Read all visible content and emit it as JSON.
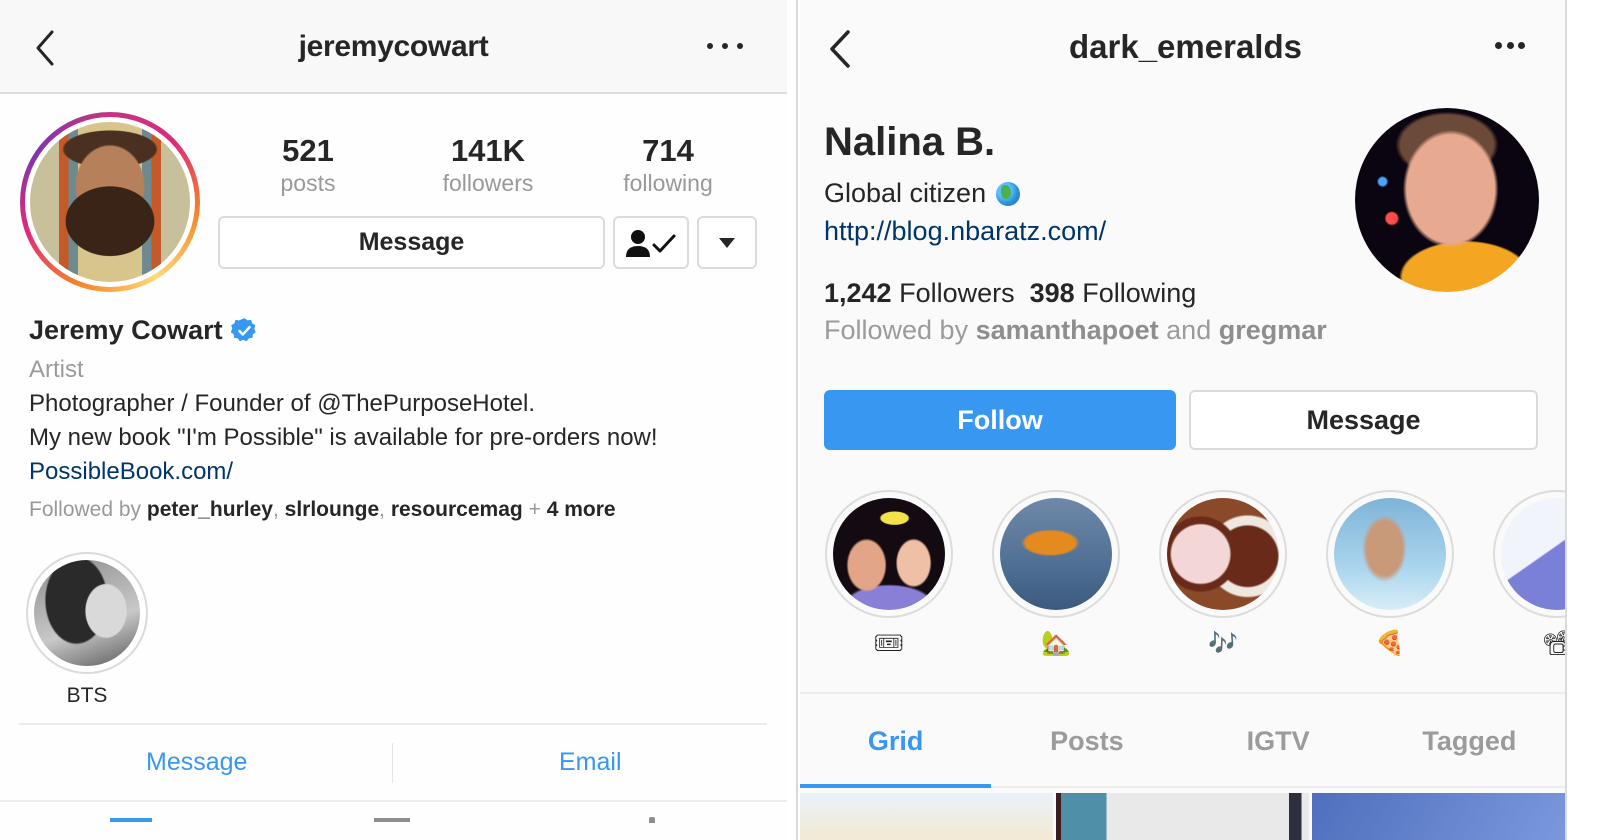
{
  "left_profile": {
    "username": "jeremycowart",
    "stats": [
      {
        "value": "521",
        "label": "posts"
      },
      {
        "value": "141K",
        "label": "followers"
      },
      {
        "value": "714",
        "label": "following"
      }
    ],
    "buttons": {
      "message": "Message"
    },
    "full_name": "Jeremy Cowart",
    "verified": true,
    "category": "Artist",
    "bio_lines": [
      "Photographer / Founder of @ThePurposeHotel.",
      "My new book \"I'm Possible\" is available for pre-orders now!"
    ],
    "website": "PossibleBook.com/",
    "followed_by": {
      "prefix": "Followed by",
      "users": [
        "peter_hurley",
        "slrlounge",
        "resourcemag"
      ],
      "more": "4 more"
    },
    "highlights": [
      {
        "label": "BTS"
      }
    ],
    "contact": {
      "message": "Message",
      "email": "Email"
    }
  },
  "right_profile": {
    "username": "dark_emeralds",
    "full_name": "Nalina B.",
    "bio": "Global citizen",
    "website": "http://blog.nbaratz.com/",
    "followers_count": "1,242",
    "followers_label": "Followers",
    "following_count": "398",
    "following_label": "Following",
    "followed_by": {
      "prefix": "Followed by",
      "user1": "samanthapoet",
      "conj": "and",
      "user2": "gregmar"
    },
    "buttons": {
      "follow": "Follow",
      "message": "Message"
    },
    "highlights": [
      {
        "emoji": "🎟",
        "icon": "admit-one-ticket-icon"
      },
      {
        "emoji": "🏡",
        "icon": "house-garden-icon"
      },
      {
        "emoji": "🎶",
        "icon": "music-notes-icon"
      },
      {
        "emoji": "🍕",
        "icon": "pizza-icon"
      },
      {
        "emoji": "📽",
        "icon": "film-projector-icon"
      }
    ],
    "tabs": [
      "Grid",
      "Posts",
      "IGTV",
      "Tagged"
    ],
    "active_tab": "Grid"
  },
  "colors": {
    "accent_blue": "#3897f0",
    "link_blue": "#003569",
    "text_dark": "#262626",
    "text_muted": "#999999"
  }
}
